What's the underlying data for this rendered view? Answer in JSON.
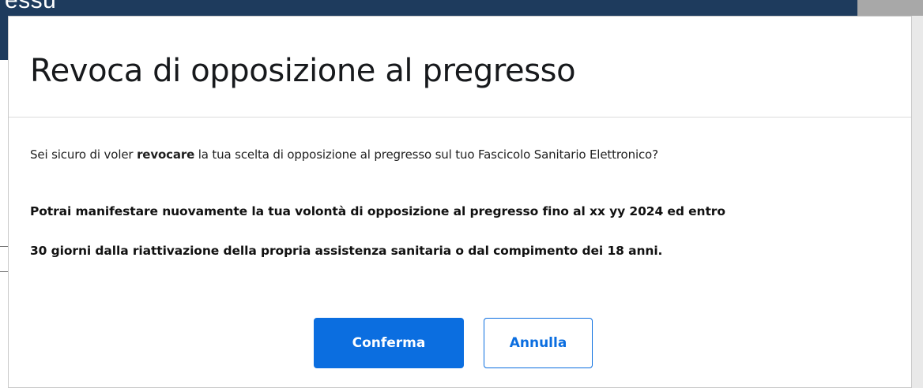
{
  "background": {
    "header_partial_text": "essu"
  },
  "modal": {
    "title": "Revoca di opposizione al pregresso",
    "question": {
      "before": "Sei sicuro di voler ",
      "emphasis": "revocare",
      "after": " la tua scelta di opposizione al pregresso sul tuo Fascicolo Sanitario Elettronico?"
    },
    "notice_lines": [
      "Potrai manifestare nuovamente la tua volontà di opposizione al pregresso fino al xx yy 2024 ed entro",
      "30 giorni dalla riattivazione della propria assistenza sanitaria o dal compimento dei 18 anni."
    ],
    "buttons": {
      "confirm_label": "Conferma",
      "cancel_label": "Annulla"
    }
  },
  "colors": {
    "primary": "#0b6ee0",
    "header_bg": "#1e3b5d",
    "text": "#17191c"
  }
}
